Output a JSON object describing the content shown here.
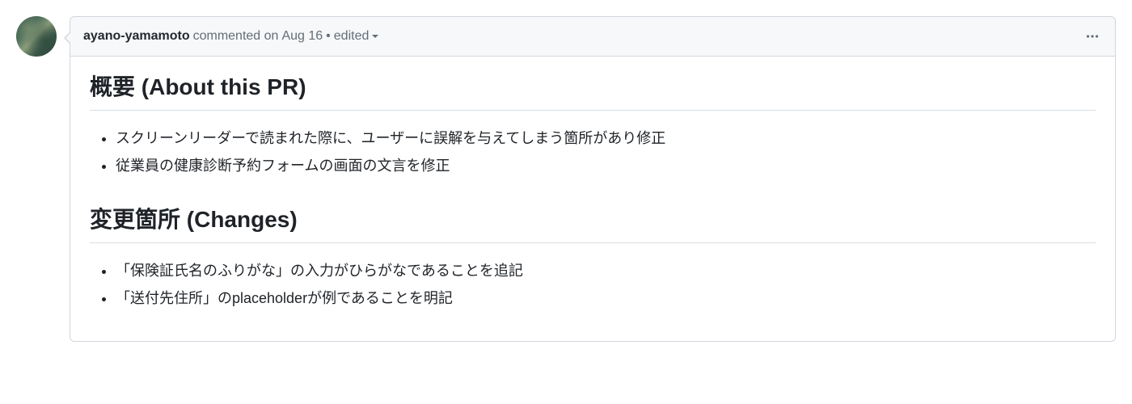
{
  "comment": {
    "author": "ayano-yamamoto",
    "action_text": "commented on",
    "date": "Aug 16",
    "separator": "•",
    "edited_label": "edited",
    "sections": [
      {
        "heading": "概要 (About this PR)",
        "items": [
          "スクリーンリーダーで読まれた際に、ユーザーに誤解を与えてしまう箇所があり修正",
          "従業員の健康診断予約フォームの画面の文言を修正"
        ]
      },
      {
        "heading": "変更箇所 (Changes)",
        "items": [
          "「保険証氏名のふりがな」の入力がひらがなであることを追記",
          "「送付先住所」のplaceholderが例であることを明記"
        ]
      }
    ]
  }
}
